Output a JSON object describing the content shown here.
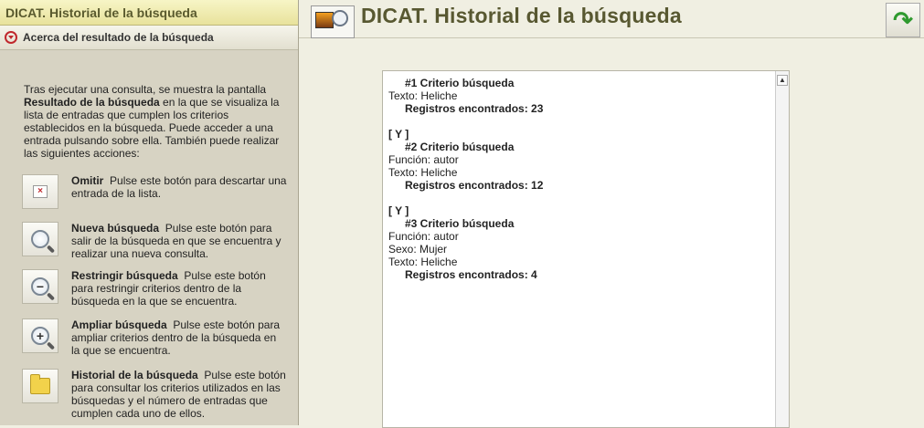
{
  "sidebar": {
    "app_title": "DICAT. Historial de la búsqueda",
    "section_label": "Acerca del resultado de la búsqueda",
    "intro": {
      "p1": "Tras ejecutar una consulta, se muestra la pantalla ",
      "bold": "Resultado de la búsqueda",
      "p2": " en la que se visualiza la lista de entradas que cumplen los criterios establecidos en la búsqueda. Puede acceder a una entrada pulsando sobre ella. También puede realizar las siguientes acciones:"
    },
    "actions": [
      {
        "title": "Omitir",
        "desc": "Pulse este botón para descartar una entrada de la lista.",
        "icon": "omit-icon"
      },
      {
        "title": "Nueva búsqueda",
        "desc": "Pulse este botón para salir de la búsqueda en que se encuentra y realizar una nueva consulta.",
        "icon": "magnifier-icon"
      },
      {
        "title": "Restringir búsqueda",
        "desc": "Pulse este botón para restringir criterios dentro de la búsqueda en la que se encuentra.",
        "icon": "zoom-out-icon"
      },
      {
        "title": "Ampliar búsqueda",
        "desc": "Pulse este botón para ampliar criterios dentro de la búsqueda en la que se encuentra.",
        "icon": "zoom-in-icon"
      },
      {
        "title": "Historial de la búsqueda",
        "desc": "Pulse este botón para consultar los criterios utilizados en las búsquedas y el número de entradas que cumplen cada uno de ellos.",
        "icon": "folder-icon"
      }
    ]
  },
  "header": {
    "title": "DICAT. Historial de la búsqueda"
  },
  "history": [
    {
      "title": "#1 Criterio búsqueda",
      "lines": [
        "Texto: Heliche"
      ],
      "count": "Registros encontrados: 23"
    },
    {
      "conj": "[ Y ]",
      "title": "#2 Criterio búsqueda",
      "lines": [
        "Función: autor",
        "Texto: Heliche"
      ],
      "count": "Registros encontrados: 12"
    },
    {
      "conj": "[ Y ]",
      "title": "#3 Criterio búsqueda",
      "lines": [
        "Función: autor",
        "Sexo: Mujer",
        "Texto: Heliche"
      ],
      "count": "Registros encontrados: 4"
    }
  ]
}
